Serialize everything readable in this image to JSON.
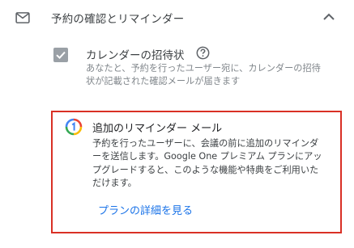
{
  "section": {
    "title": "予約の確認とリマインダー",
    "icon": "mail-icon",
    "toggle_icon": "chevron-up-icon"
  },
  "option": {
    "checked": true,
    "title": "カレンダーの招待状",
    "help_icon": "help-icon",
    "description": "あなたと、予約を行ったユーザー宛に、カレンダーの招待状が記載された確認メールが届きます"
  },
  "promo": {
    "icon": "google-one-icon",
    "title": "追加のリマインダー メール",
    "description": "予約を行ったユーザーに、会議の前に追加のリマインダーを送信します。Google One プレミアム プランにアップグレードすると、このような機能や特典をご利用いただけます。",
    "link": "プランの詳細を見る",
    "highlight_color": "#d93025",
    "link_color": "#1a73e8"
  }
}
